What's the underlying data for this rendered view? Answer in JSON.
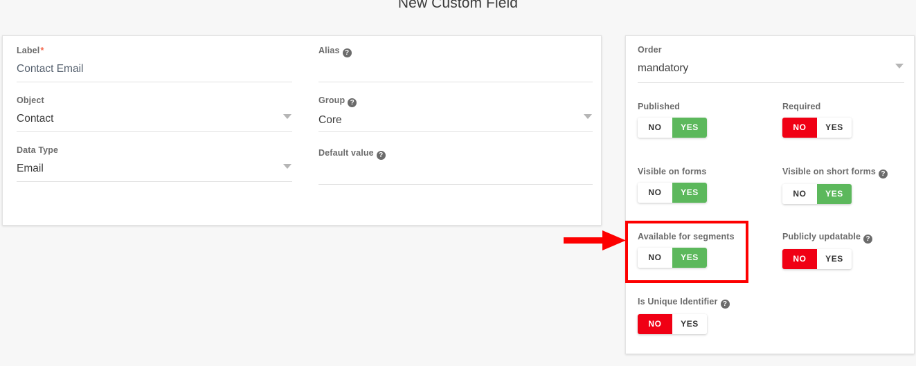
{
  "page": {
    "title": "New Custom Field"
  },
  "left_panel": {
    "columns": [
      {
        "fields": [
          {
            "label": "Label",
            "required": true,
            "value": "Contact Email",
            "type": "text",
            "help": false
          },
          {
            "label": "Object",
            "required": false,
            "value": "Contact",
            "type": "select",
            "help": false
          },
          {
            "label": "Data Type",
            "required": false,
            "value": "Email",
            "type": "select",
            "help": false
          }
        ]
      },
      {
        "fields": [
          {
            "label": "Alias",
            "required": false,
            "value": "",
            "type": "text",
            "help": true
          },
          {
            "label": "Group",
            "required": false,
            "value": "Core",
            "type": "select",
            "help": true
          },
          {
            "label": "Default value",
            "required": false,
            "value": "",
            "type": "text",
            "help": true
          }
        ]
      }
    ]
  },
  "right_panel": {
    "order": {
      "label": "Order",
      "value": "mandatory",
      "type": "select"
    },
    "toggles": [
      {
        "label": "Published",
        "help": false,
        "no_label": "NO",
        "yes_label": "YES",
        "selected": "YES"
      },
      {
        "label": "Required",
        "help": false,
        "no_label": "NO",
        "yes_label": "YES",
        "selected": "NO"
      },
      {
        "label": "Visible on forms",
        "help": false,
        "no_label": "NO",
        "yes_label": "YES",
        "selected": "YES"
      },
      {
        "label": "Visible on short forms",
        "help": true,
        "no_label": "NO",
        "yes_label": "YES",
        "selected": "YES"
      },
      {
        "label": "Available for segments",
        "help": false,
        "no_label": "NO",
        "yes_label": "YES",
        "selected": "YES"
      },
      {
        "label": "Publicly updatable",
        "help": true,
        "no_label": "NO",
        "yes_label": "YES",
        "selected": "NO"
      },
      {
        "label": "Is Unique Identifier",
        "help": true,
        "no_label": "NO",
        "yes_label": "YES",
        "selected": "NO"
      }
    ]
  },
  "annotations": {
    "highlight_color": "#fd0000",
    "highlighted_control": "Available for segments",
    "arrow_color": "#fd0000"
  },
  "colors": {
    "yes_green": "#5cb85c",
    "no_red": "#f00014",
    "required_star": "#f4694f",
    "background": "#f7f7f7",
    "panel": "#ffffff",
    "label_grey": "#6b6b6b",
    "value_blue_grey": "#55606e"
  },
  "icons": {
    "help": "?",
    "caret": "chevron-down"
  }
}
